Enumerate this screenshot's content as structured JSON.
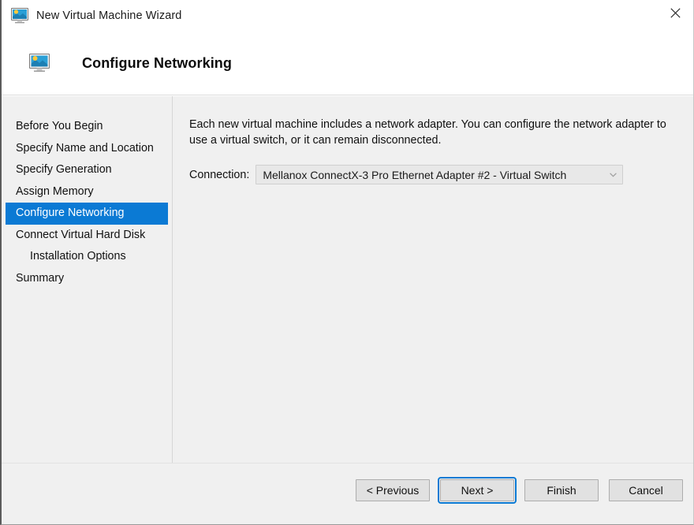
{
  "window": {
    "title": "New Virtual Machine Wizard",
    "icon": "virtual-machine-monitor-icon",
    "close_label": "×"
  },
  "header": {
    "title": "Configure Networking",
    "icon": "virtual-machine-monitor-icon"
  },
  "sidebar": {
    "items": [
      {
        "label": "Before You Begin",
        "selected": false,
        "indent": false
      },
      {
        "label": "Specify Name and Location",
        "selected": false,
        "indent": false
      },
      {
        "label": "Specify Generation",
        "selected": false,
        "indent": false
      },
      {
        "label": "Assign Memory",
        "selected": false,
        "indent": false
      },
      {
        "label": "Configure Networking",
        "selected": true,
        "indent": false
      },
      {
        "label": "Connect Virtual Hard Disk",
        "selected": false,
        "indent": false
      },
      {
        "label": "Installation Options",
        "selected": false,
        "indent": true
      },
      {
        "label": "Summary",
        "selected": false,
        "indent": false
      }
    ]
  },
  "main": {
    "description": "Each new virtual machine includes a network adapter. You can configure the network adapter to use a virtual switch, or it can remain disconnected.",
    "connection_label": "Connection:",
    "connection_value": "Mellanox ConnectX-3 Pro Ethernet Adapter #2 - Virtual Switch",
    "connection_chevron_icon": "chevron-down-icon"
  },
  "footer": {
    "buttons": [
      {
        "label": "< Previous",
        "focused": false
      },
      {
        "label": "Next >",
        "focused": true
      },
      {
        "label": "Finish",
        "focused": false
      },
      {
        "label": "Cancel",
        "focused": false
      }
    ]
  },
  "colors": {
    "accent": "#0b7ad4",
    "body_background": "#f0f0f0",
    "header_background": "#ffffff",
    "button_face": "#e1e1e1"
  }
}
